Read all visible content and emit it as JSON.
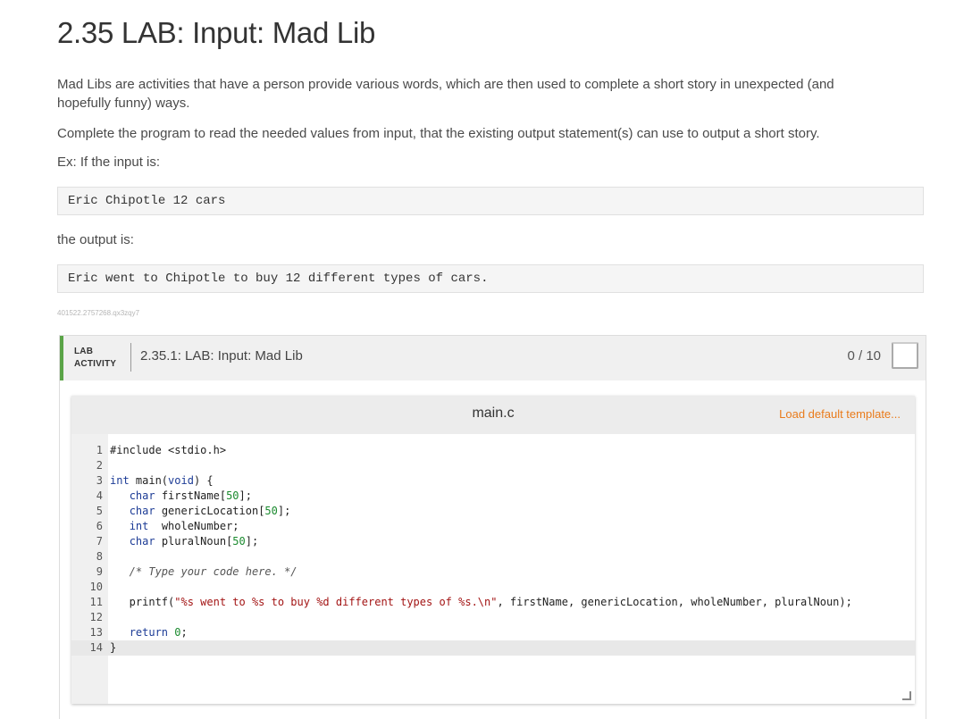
{
  "page": {
    "title": "2.35 LAB: Input: Mad Lib",
    "intro": "Mad Libs are activities that have a person provide various words, which are then used to complete a short story in unexpected (and hopefully funny) ways.",
    "instructions": "Complete the program to read the needed values from input, that the existing output statement(s) can use to output a short story.",
    "example_label": "Ex: If the input is:",
    "example_input": "Eric Chipotle 12 cars",
    "output_label": "the output is:",
    "example_output": "Eric went to Chipotle to buy 12 different types of cars.",
    "content_id": "401522.2757268.qx3zqy7"
  },
  "lab": {
    "tag_line1": "LAB",
    "tag_line2": "ACTIVITY",
    "name": "2.35.1: LAB: Input: Mad Lib",
    "score": "0 / 10",
    "accent_color": "#5aa447"
  },
  "editor": {
    "file_name": "main.c",
    "load_template_label": "Load default template...",
    "link_color": "#e97b1b",
    "lines": [
      {
        "n": "1",
        "text": "#include <stdio.h>"
      },
      {
        "n": "2",
        "text": ""
      },
      {
        "n": "3",
        "text": "int main(void) {"
      },
      {
        "n": "4",
        "text": "   char firstName[50];"
      },
      {
        "n": "5",
        "text": "   char genericLocation[50];"
      },
      {
        "n": "6",
        "text": "   int  wholeNumber;"
      },
      {
        "n": "7",
        "text": "   char pluralNoun[50];"
      },
      {
        "n": "8",
        "text": ""
      },
      {
        "n": "9",
        "text": "   /* Type your code here. */"
      },
      {
        "n": "10",
        "text": ""
      },
      {
        "n": "11",
        "text": "   printf(\"%s went to %s to buy %d different types of %s.\\n\", firstName, genericLocation, wholeNumber, pluralNoun);"
      },
      {
        "n": "12",
        "text": ""
      },
      {
        "n": "13",
        "text": "   return 0;"
      },
      {
        "n": "14",
        "text": "}"
      }
    ]
  }
}
